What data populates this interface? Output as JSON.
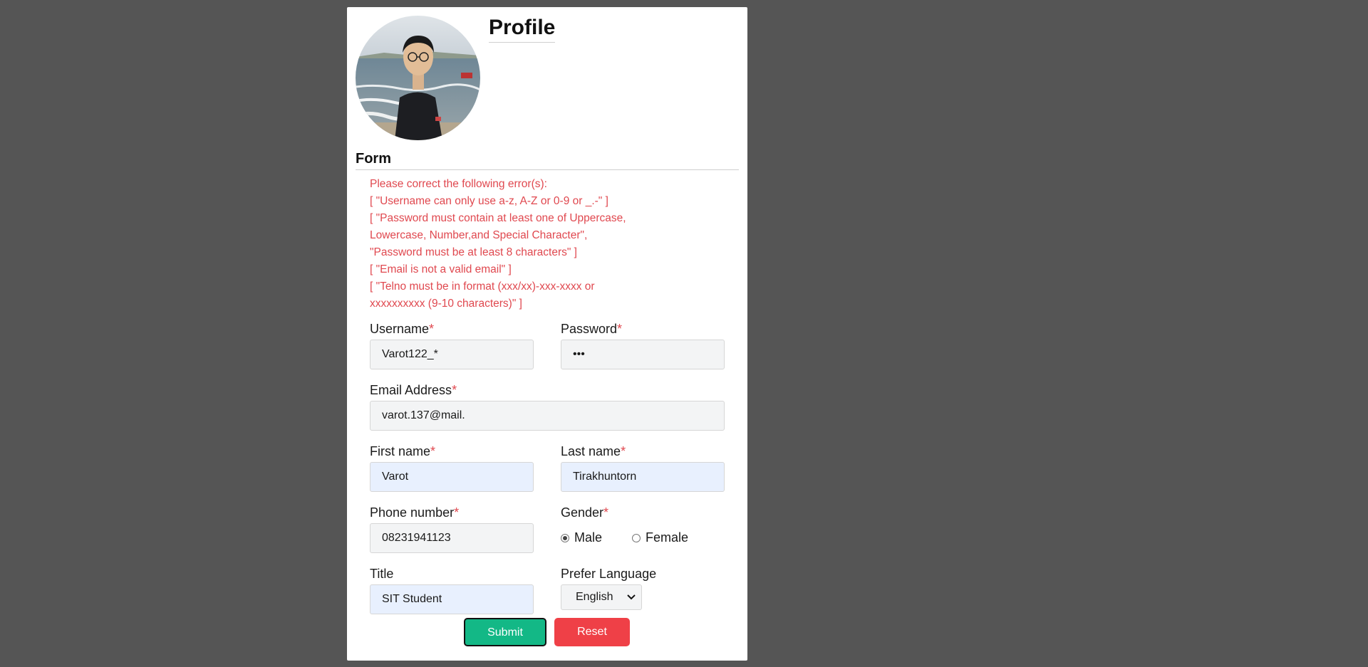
{
  "profile": {
    "title": "Profile"
  },
  "form": {
    "title": "Form",
    "errors": {
      "heading": "Please correct the following error(s):",
      "lines": [
        "[ \"Username can only use a-z, A-Z or 0-9 or _.-\" ]",
        "[ \"Password must contain at least one of Uppercase,",
        "Lowercase, Number,and Special Character\",",
        "\"Password must be at least 8 characters\" ]",
        "[ \"Email is not a valid email\" ]",
        "[ \"Telno must be in format (xxx/xx)-xxx-xxxx or",
        "xxxxxxxxxx (9-10 characters)\" ]"
      ]
    },
    "required_mark": "*",
    "username": {
      "label": "Username",
      "value": "Varot122_*"
    },
    "password": {
      "label": "Password",
      "value": "•••"
    },
    "email": {
      "label": "Email Address",
      "value": "varot.137@mail."
    },
    "first_name": {
      "label": "First name",
      "value": "Varot"
    },
    "last_name": {
      "label": "Last name",
      "value": "Tirakhuntorn"
    },
    "phone": {
      "label": "Phone number",
      "value": "08231941123"
    },
    "gender": {
      "label": "Gender",
      "options": [
        "Male",
        "Female"
      ],
      "selected": "Male"
    },
    "title_field": {
      "label": "Title",
      "value": "SIT Student"
    },
    "language": {
      "label": "Prefer Language",
      "selected": "English"
    },
    "submit_label": "Submit",
    "reset_label": "Reset"
  },
  "colors": {
    "background": "#555555",
    "error": "#e0484f",
    "submit": "#13b886",
    "reset": "#ef4047",
    "autofill": "#e8f0fe"
  },
  "icons": [
    "avatar-photo",
    "chevron-down-icon",
    "radio-icon"
  ]
}
